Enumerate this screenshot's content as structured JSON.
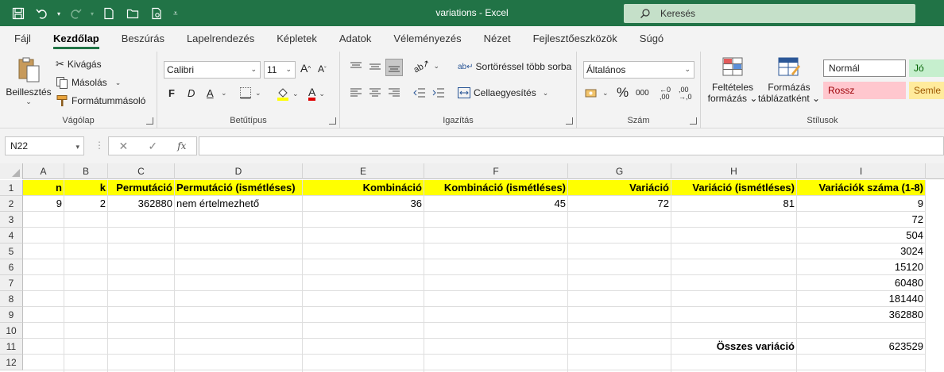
{
  "window": {
    "title": "variations  -  Excel",
    "search_placeholder": "Keresés"
  },
  "menu": [
    "Fájl",
    "Kezdőlap",
    "Beszúrás",
    "Lapelrendezés",
    "Képletek",
    "Adatok",
    "Véleményezés",
    "Nézet",
    "Fejlesztőeszközök",
    "Súgó"
  ],
  "active_menu": "Kezdőlap",
  "ribbon": {
    "clipboard": {
      "label": "Vágólap",
      "paste": "Beillesztés",
      "cut": "Kivágás",
      "copy": "Másolás",
      "format_painter": "Formátummásoló"
    },
    "font": {
      "label": "Betűtípus",
      "name": "Calibri",
      "size": "11",
      "bold": "F",
      "italic": "D",
      "underline": "A"
    },
    "alignment": {
      "label": "Igazítás",
      "wrap": "Sortöréssel több sorba",
      "merge": "Cellaegyesítés"
    },
    "number": {
      "label": "Szám",
      "format": "Általános",
      "thousands": "000"
    },
    "styles": {
      "label": "Stílusok",
      "conditional_1": "Feltételes",
      "conditional_2": "formázás",
      "table_1": "Formázás",
      "table_2": "táblázatként",
      "normal": "Normál",
      "good": "Jó",
      "bad": "Rossz",
      "neutral": "Semle"
    }
  },
  "formula_bar": {
    "name_box": "N22",
    "fx": "fx",
    "formula": ""
  },
  "sheet": {
    "columns": [
      "A",
      "B",
      "C",
      "D",
      "E",
      "F",
      "G",
      "H",
      "I"
    ],
    "rows": [
      "1",
      "2",
      "3",
      "4",
      "5",
      "6",
      "7",
      "8",
      "9",
      "10",
      "11",
      "12"
    ],
    "header_row": [
      "n",
      "k",
      "Permutáció",
      "Permutáció (ismétléses)",
      "Kombináció",
      "Kombináció (ismétléses)",
      "Variáció",
      "Variáció  (ismétléses)",
      "Variációk száma (1-8)"
    ],
    "row2": [
      "9",
      "2",
      "362880",
      "nem értelmezhető",
      "36",
      "45",
      "72",
      "81",
      "9"
    ],
    "col_i_values": [
      "72",
      "504",
      "3024",
      "15120",
      "60480",
      "181440",
      "362880"
    ],
    "total_label": "Összes variáció",
    "total_value": "623529"
  },
  "colors": {
    "accent": "#217346",
    "header_fill": "#ffff00",
    "bad_fill": "#ffc7ce",
    "good_fill": "#c6efce",
    "neutral_fill": "#ffeb9c"
  }
}
